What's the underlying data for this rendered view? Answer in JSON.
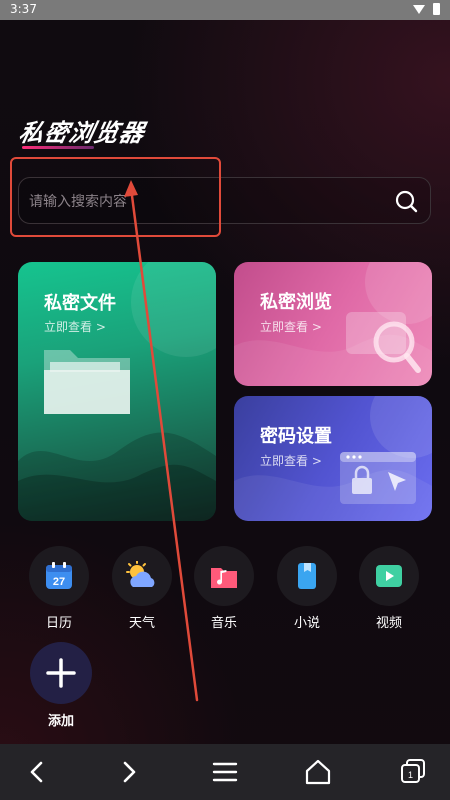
{
  "status_bar": {
    "time": "3:37"
  },
  "brand": {
    "title": "私密浏览器"
  },
  "search": {
    "placeholder": "请输入搜索内容"
  },
  "cards": {
    "files": {
      "title": "私密文件",
      "subtitle": "立即查看 >"
    },
    "browse": {
      "title": "私密浏览",
      "subtitle": "立即查看 >"
    },
    "password": {
      "title": "密码设置",
      "subtitle": "立即查看 >"
    }
  },
  "shortcuts": [
    {
      "label": "日历",
      "icon": "calendar-icon",
      "badge": "27"
    },
    {
      "label": "天气",
      "icon": "weather-icon"
    },
    {
      "label": "音乐",
      "icon": "music-icon"
    },
    {
      "label": "小说",
      "icon": "novel-icon"
    },
    {
      "label": "视频",
      "icon": "video-icon"
    }
  ],
  "add": {
    "label": "添加"
  },
  "navbar": {
    "items": [
      "back-icon",
      "forward-icon",
      "menu-icon",
      "home-icon",
      "tabs-icon"
    ],
    "tab_count": "1"
  },
  "colors": {
    "accent_pink": "#ff2e7a",
    "annotation_red": "#e04a3a",
    "card_green": "#16c48f",
    "card_pink": "#e06aa7",
    "card_blue": "#5254d1"
  }
}
